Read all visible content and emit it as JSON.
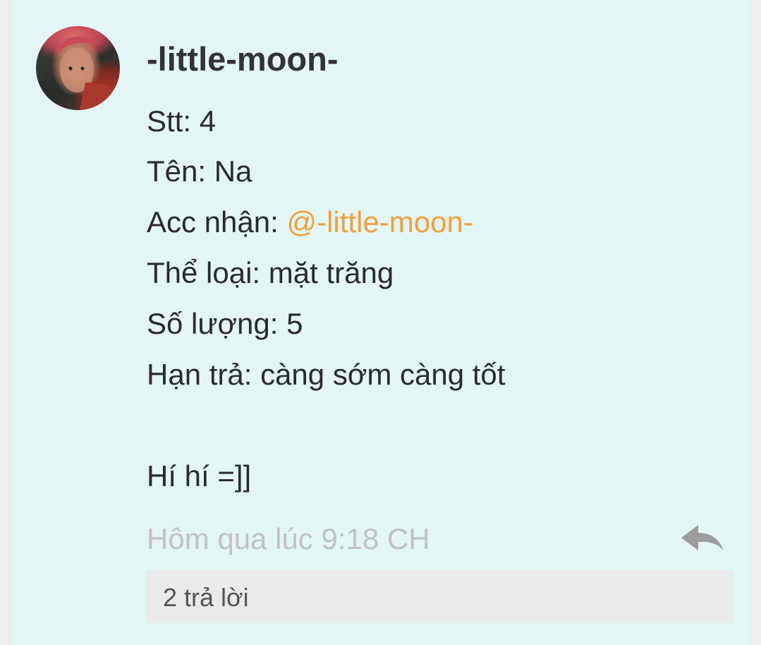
{
  "comment": {
    "username": "-little-moon-",
    "lines": [
      "Stt: 4",
      "Tên: Na",
      "Thể loại: mặt trăng",
      "Số lượng: 5",
      "Hạn trả: càng sớm càng tốt",
      "Hí hí =]]"
    ],
    "acc_label": "Acc nhận: ",
    "acc_mention": "@-little-moon-",
    "timestamp": "Hôm qua lúc 9:18 CH",
    "reply_icon": "reply-arrow-icon",
    "replies_count_label": "2 trả lời"
  },
  "colors": {
    "card_background": "#e3f5f5",
    "mention": "#f2a03d",
    "timestamp": "#c2c2c2",
    "replies_bar": "#eaeaea"
  }
}
